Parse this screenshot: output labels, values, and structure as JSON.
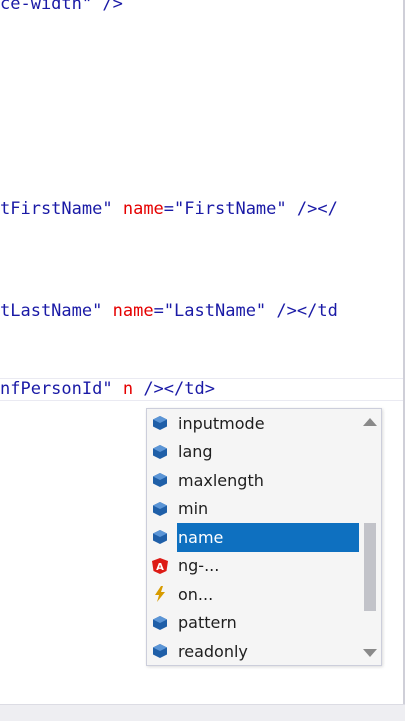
{
  "code": {
    "line1": {
      "str": "ce-width\"",
      "punct": " />"
    },
    "line2": {
      "str": "tFirstName\"",
      "attr": "name",
      "eq": "=",
      "str2": "\"FirstName\"",
      "punct": " /></"
    },
    "line3": {
      "str": "tLastName\"",
      "attr": "name",
      "eq": "=",
      "str2": "\"LastName\"",
      "punct": " /></td"
    },
    "line4": {
      "str": "nfPersonId\"",
      "attr": " n",
      "punct": " /></td>"
    }
  },
  "intellisense": {
    "items": [
      {
        "label": "inputmode",
        "icon": "property-icon",
        "selected": false
      },
      {
        "label": "lang",
        "icon": "property-icon",
        "selected": false
      },
      {
        "label": "maxlength",
        "icon": "property-icon",
        "selected": false
      },
      {
        "label": "min",
        "icon": "property-icon",
        "selected": false
      },
      {
        "label": "name",
        "icon": "property-icon",
        "selected": true
      },
      {
        "label": "ng-...",
        "icon": "angular-icon",
        "selected": false
      },
      {
        "label": "on...",
        "icon": "event-icon",
        "selected": false
      },
      {
        "label": "pattern",
        "icon": "property-icon",
        "selected": false
      },
      {
        "label": "readonly",
        "icon": "property-icon",
        "selected": false
      }
    ]
  },
  "colors": {
    "selection": "#0e70c0",
    "string": "#1a1aa6",
    "attribute": "#e50000",
    "property_icon": "#1f5fa8",
    "angular_icon": "#dd1b16",
    "event_icon": "#d79b00"
  }
}
